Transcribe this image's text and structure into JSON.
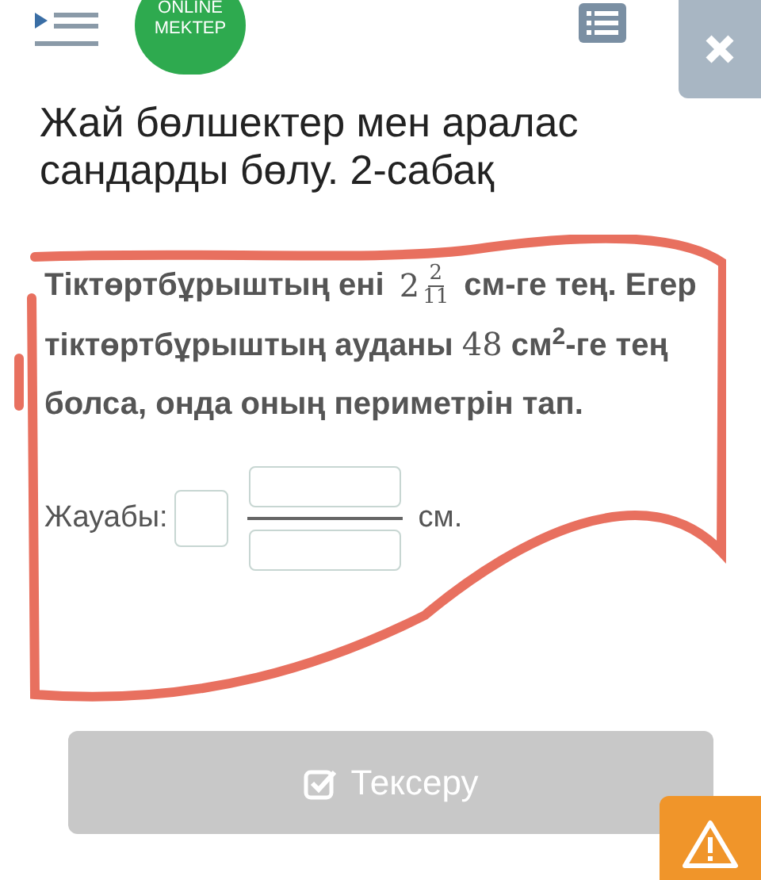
{
  "logo": {
    "line_1": "ONLINE",
    "line_2": "MEKTEP"
  },
  "title": "Жай бөлшектер мен аралас сандарды бөлу. 2-сабақ",
  "question": [
    {
      "kind": "text",
      "text": "Тіктөртбұрыштың ені "
    },
    {
      "kind": "mixed",
      "whole": "2",
      "numerator": "2",
      "denominator": "11"
    },
    {
      "kind": "text",
      "text": " см-ге тең. Егер тіктөртбұрыштың ауданы "
    },
    {
      "kind": "math",
      "text": "48"
    },
    {
      "kind": "text",
      "text": " см$^{2}$-ге тең болса, онда оның периметрін тап."
    }
  ],
  "answer": {
    "label": "Жауабы:",
    "unit": "см."
  },
  "check_button": {
    "label": "Тексеру",
    "disabled": true
  }
}
